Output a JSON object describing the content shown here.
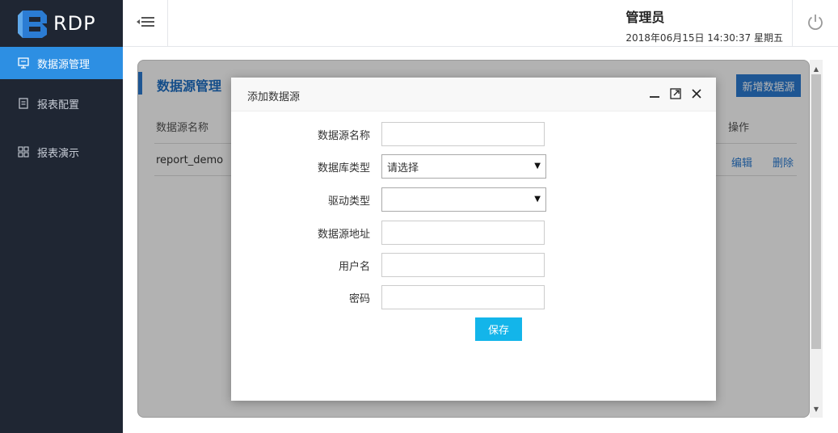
{
  "app": {
    "logo_text": "RDP"
  },
  "sidebar": {
    "items": [
      {
        "label": "数据源管理",
        "icon": "monitor-icon",
        "active": true
      },
      {
        "label": "报表配置",
        "icon": "document-icon",
        "active": false
      },
      {
        "label": "报表演示",
        "icon": "grid-icon",
        "active": false
      }
    ]
  },
  "header": {
    "user_name": "管理员",
    "datetime": "2018年06月15日 14:30:37 星期五"
  },
  "panel": {
    "title": "数据源管理",
    "add_button": "新增数据源",
    "columns": [
      "数据源名称",
      "操作"
    ],
    "rows": [
      {
        "name": "report_demo",
        "edit": "编辑",
        "delete": "删除"
      }
    ]
  },
  "modal": {
    "title": "添加数据源",
    "fields": {
      "name_label": "数据源名称",
      "name_value": "",
      "dbtype_label": "数据库类型",
      "dbtype_value": "请选择",
      "driver_label": "驱动类型",
      "driver_value": "",
      "address_label": "数据源地址",
      "address_value": "",
      "username_label": "用户名",
      "username_value": "",
      "password_label": "密码",
      "password_value": ""
    },
    "save_button": "保存"
  },
  "colors": {
    "sidebar_bg": "#1f2633",
    "active_blue": "#2d8fe3",
    "primary": "#2b7cd3",
    "save": "#13b5ea"
  }
}
